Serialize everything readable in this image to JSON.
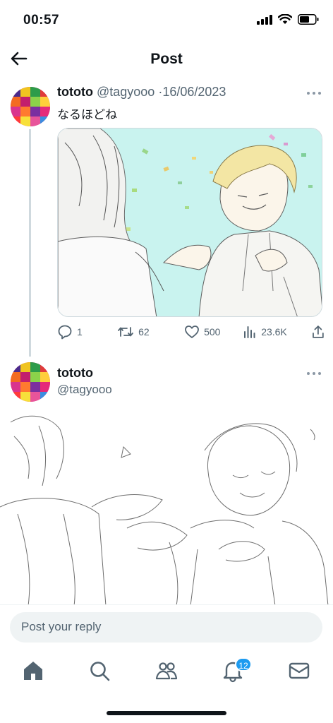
{
  "status_bar": {
    "time": "00:57"
  },
  "header": {
    "title": "Post"
  },
  "tweet": {
    "name": "tototo",
    "handle": "@tagyooo",
    "separator": "·",
    "date": "16/06/2023",
    "text": "なるほどね",
    "replies": "1",
    "reposts": "62",
    "likes": "500",
    "views": "23.6K"
  },
  "reply_tweet": {
    "name": "tototo",
    "handle": "@tagyooo"
  },
  "reply_box": {
    "placeholder": "Post your reply"
  },
  "tabbar": {
    "notifications_badge": "12"
  },
  "colors": {
    "accent": "#1d9bf0",
    "muted": "#536471",
    "media_bg": "#c9f3ef"
  }
}
